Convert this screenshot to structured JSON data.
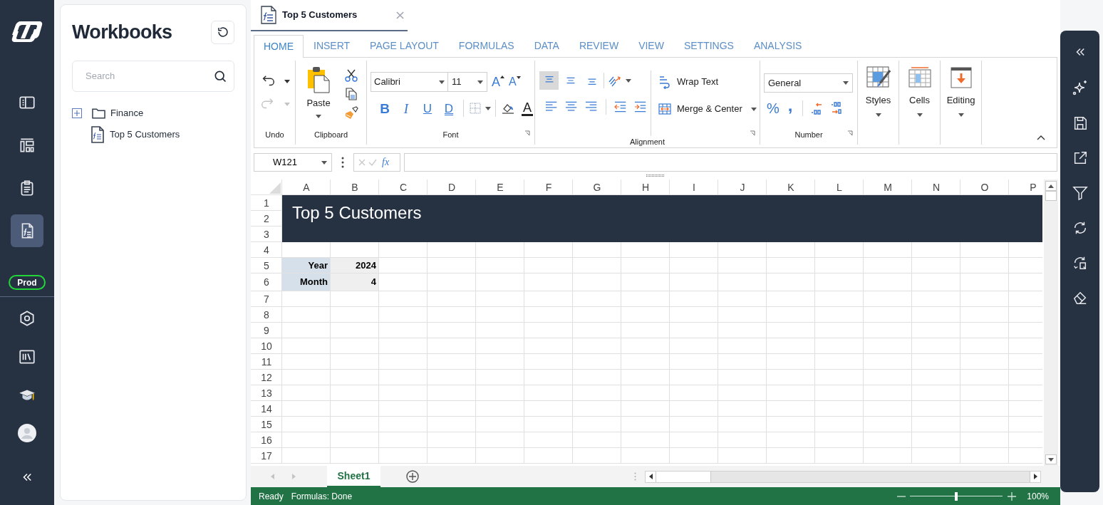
{
  "nav": {
    "items": [
      {
        "selected": false
      },
      {
        "selected": false
      },
      {
        "selected": false
      },
      {
        "selected": true
      },
      {
        "selected": false
      },
      {
        "selected": false
      },
      {
        "selected": false
      }
    ],
    "environment": "Prod"
  },
  "workbooks": {
    "title": "Workbooks",
    "search": {
      "placeholder": "Search"
    },
    "tree": [
      {
        "kind": "folder",
        "label": "Finance",
        "expanded": false
      },
      {
        "kind": "workbook",
        "label": "Top 5 Customers"
      }
    ]
  },
  "document_tab": {
    "title": "Top 5 Customers"
  },
  "ribbon": {
    "tabs": [
      {
        "label": "HOME",
        "selected": true
      },
      {
        "label": "INSERT",
        "selected": false
      },
      {
        "label": "PAGE LAYOUT",
        "selected": false
      },
      {
        "label": "FORMULAS",
        "selected": false
      },
      {
        "label": "DATA",
        "selected": false
      },
      {
        "label": "REVIEW",
        "selected": false
      },
      {
        "label": "VIEW",
        "selected": false
      },
      {
        "label": "SETTINGS",
        "selected": false
      },
      {
        "label": "ANALYSIS",
        "selected": false
      }
    ],
    "undo": {
      "label": "Undo",
      "buttons": [
        {
          "kind": "undo",
          "disabled": false
        },
        {
          "kind": "redo",
          "disabled": true
        }
      ]
    },
    "clipboard": {
      "label": "Clipboard",
      "paste": "Paste"
    },
    "font": {
      "label": "Font",
      "name": "Calibri",
      "size": "11",
      "grow": "A",
      "shrink": "A",
      "styles": [
        "B",
        "I",
        "U",
        "D"
      ],
      "text_color_label": "A"
    },
    "alignment": {
      "label": "Alignment",
      "vertical": [
        {
          "selected": true
        },
        {
          "selected": false
        },
        {
          "selected": false
        }
      ],
      "wrap_text": "Wrap Text",
      "merge": "Merge & Center"
    },
    "number": {
      "label": "Number",
      "format": "General",
      "percent": "%",
      "comma": ","
    },
    "styles": "Styles",
    "cells": "Cells",
    "editing": "Editing"
  },
  "formula_bar": {
    "name_box": "W121",
    "function_label": "fx"
  },
  "sheet": {
    "columns": [
      "A",
      "B",
      "C",
      "D",
      "E",
      "F",
      "G",
      "H",
      "I",
      "J",
      "K",
      "L",
      "M",
      "N",
      "O",
      "P"
    ],
    "rows": [
      "1",
      "2",
      "3",
      "4",
      "5",
      "6",
      "7",
      "8",
      "9",
      "10",
      "11",
      "12",
      "13",
      "14",
      "15",
      "16",
      "17"
    ],
    "title": "Top 5 Customers",
    "parameters": [
      {
        "label": "Year",
        "value": "2024"
      },
      {
        "label": "Month",
        "value": "4"
      }
    ]
  },
  "sheet_tabs": [
    {
      "label": "Sheet1",
      "selected": true
    }
  ],
  "status_bar": {
    "items": [
      "Ready",
      "Formulas: Done"
    ],
    "zoom": {
      "level": 0.5,
      "reading": "100%"
    }
  }
}
